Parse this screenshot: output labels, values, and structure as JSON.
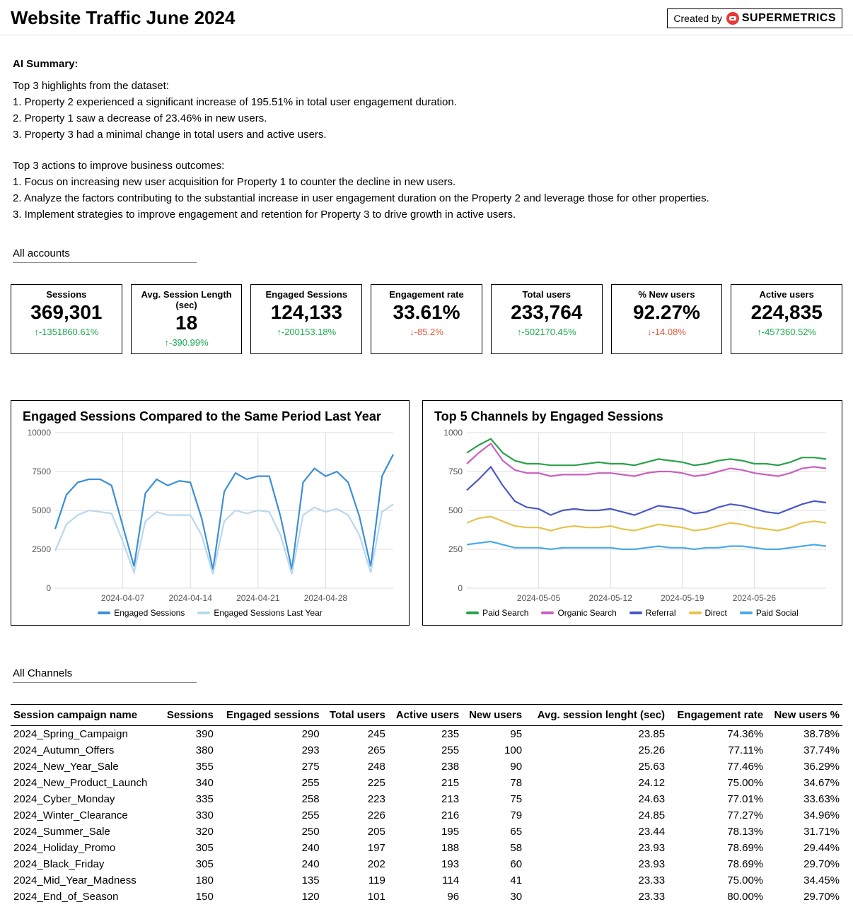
{
  "header": {
    "title": "Website Traffic June 2024",
    "created_by_label": "Created by",
    "brand": "SUPERMETRICS"
  },
  "summary": {
    "label": "AI Summary:",
    "highlights_label": "Top 3 highlights from the dataset:",
    "highlights": [
      "1. Property 2 experienced a significant increase of 195.51% in total user engagement duration.",
      "2. Property 1 saw a decrease of 23.46% in new users.",
      "3. Property 3 had a minimal change in total users and active users."
    ],
    "actions_label": "Top 3 actions to improve business outcomes:",
    "actions": [
      "1. Focus on increasing new user acquisition for Property 1 to counter the decline in new users.",
      "2. Analyze the factors contributing to the substantial increase in user engagement duration on the Property 2 and leverage those for other properties.",
      "3. Implement strategies to improve engagement and retention for Property 3 to drive growth in active users."
    ]
  },
  "filters": {
    "accounts": "All accounts",
    "channels": "All Channels"
  },
  "kpis": [
    {
      "label": "Sessions",
      "value": "369,301",
      "delta": "-1351860.61%",
      "dir": "up"
    },
    {
      "label": "Avg. Session Length (sec)",
      "value": "18",
      "delta": "-390.99%",
      "dir": "up"
    },
    {
      "label": "Engaged Sessions",
      "value": "124,133",
      "delta": "-200153.18%",
      "dir": "up"
    },
    {
      "label": "Engagement rate",
      "value": "33.61%",
      "delta": "-85.2%",
      "dir": "down"
    },
    {
      "label": "Total users",
      "value": "233,764",
      "delta": "-502170.45%",
      "dir": "up"
    },
    {
      "label": "% New users",
      "value": "92.27%",
      "delta": "-14.08%",
      "dir": "down"
    },
    {
      "label": "Active users",
      "value": "224,835",
      "delta": "-457360.52%",
      "dir": "up"
    }
  ],
  "chart_data": [
    {
      "type": "line",
      "title": "Engaged Sessions Compared to the Same Period Last Year",
      "xlabel": "",
      "ylabel": "",
      "x_ticks": [
        "2024-04-07",
        "2024-04-14",
        "2024-04-21",
        "2024-04-28"
      ],
      "ylim": [
        0,
        10000
      ],
      "y_ticks": [
        0,
        2500,
        5000,
        7500,
        10000
      ],
      "series": [
        {
          "name": "Engaged Sessions",
          "color": "#3b8fd6",
          "values": [
            3800,
            6000,
            6800,
            7000,
            7000,
            6600,
            4000,
            1400,
            6100,
            7000,
            6600,
            6900,
            6800,
            4500,
            1200,
            6200,
            7400,
            7000,
            7200,
            7200,
            4600,
            1200,
            6800,
            7700,
            7200,
            7500,
            6800,
            4600,
            1400,
            7200,
            8600
          ]
        },
        {
          "name": "Engaged Sessions Last Year",
          "color": "#b9d8ef",
          "values": [
            2400,
            4100,
            4700,
            5000,
            4900,
            4800,
            3000,
            1000,
            4300,
            4900,
            4700,
            4700,
            4700,
            3400,
            900,
            4300,
            5000,
            4800,
            5000,
            4900,
            3400,
            900,
            4700,
            5200,
            4900,
            5100,
            4700,
            3400,
            1000,
            4900,
            5400
          ]
        }
      ]
    },
    {
      "type": "line",
      "title": "Top 5 Channels by Engaged Sessions",
      "xlabel": "",
      "ylabel": "",
      "x_ticks": [
        "2024-05-05",
        "2024-05-12",
        "2024-05-19",
        "2024-05-26"
      ],
      "ylim": [
        0,
        1000
      ],
      "y_ticks": [
        0,
        250,
        500,
        750,
        1000
      ],
      "series": [
        {
          "name": "Paid Search",
          "color": "#2aa24a",
          "values": [
            870,
            920,
            960,
            870,
            820,
            800,
            800,
            790,
            790,
            790,
            800,
            810,
            800,
            800,
            790,
            810,
            830,
            820,
            810,
            790,
            800,
            820,
            830,
            820,
            800,
            800,
            790,
            810,
            840,
            840,
            830
          ]
        },
        {
          "name": "Organic Search",
          "color": "#c960c0",
          "values": [
            800,
            870,
            930,
            820,
            760,
            740,
            740,
            720,
            730,
            730,
            730,
            740,
            740,
            730,
            720,
            740,
            750,
            750,
            740,
            720,
            730,
            750,
            770,
            760,
            740,
            730,
            720,
            740,
            770,
            780,
            770
          ]
        },
        {
          "name": "Referral",
          "color": "#4a57c6",
          "values": [
            630,
            700,
            780,
            660,
            560,
            520,
            510,
            470,
            500,
            510,
            500,
            500,
            510,
            490,
            470,
            500,
            530,
            520,
            510,
            480,
            490,
            520,
            540,
            530,
            510,
            490,
            480,
            510,
            540,
            560,
            550
          ]
        },
        {
          "name": "Direct",
          "color": "#e7c24a",
          "values": [
            420,
            450,
            460,
            430,
            400,
            390,
            390,
            370,
            390,
            400,
            390,
            390,
            400,
            380,
            370,
            390,
            410,
            400,
            390,
            370,
            380,
            400,
            420,
            410,
            390,
            380,
            370,
            390,
            420,
            430,
            420
          ]
        },
        {
          "name": "Paid Social",
          "color": "#4aa9e7",
          "values": [
            280,
            290,
            300,
            280,
            260,
            260,
            260,
            250,
            260,
            260,
            260,
            260,
            260,
            250,
            250,
            260,
            270,
            260,
            260,
            250,
            260,
            260,
            270,
            270,
            260,
            250,
            250,
            260,
            270,
            280,
            270
          ]
        }
      ]
    }
  ],
  "table": {
    "columns": [
      "Session campaign name",
      "Sessions",
      "Engaged sessions",
      "Total users",
      "Active users",
      "New users",
      "Avg. session lenght (sec)",
      "Engagement rate",
      "New users %"
    ],
    "rows": [
      [
        "2024_Spring_Campaign",
        "390",
        "290",
        "245",
        "235",
        "95",
        "23.85",
        "74.36%",
        "38.78%"
      ],
      [
        "2024_Autumn_Offers",
        "380",
        "293",
        "265",
        "255",
        "100",
        "25.26",
        "77.11%",
        "37.74%"
      ],
      [
        "2024_New_Year_Sale",
        "355",
        "275",
        "248",
        "238",
        "90",
        "25.63",
        "77.46%",
        "36.29%"
      ],
      [
        "2024_New_Product_Launch",
        "340",
        "255",
        "225",
        "215",
        "78",
        "24.12",
        "75.00%",
        "34.67%"
      ],
      [
        "2024_Cyber_Monday",
        "335",
        "258",
        "223",
        "213",
        "75",
        "24.63",
        "77.01%",
        "33.63%"
      ],
      [
        "2024_Winter_Clearance",
        "330",
        "255",
        "226",
        "216",
        "79",
        "24.85",
        "77.27%",
        "34.96%"
      ],
      [
        "2024_Summer_Sale",
        "320",
        "250",
        "205",
        "195",
        "65",
        "23.44",
        "78.13%",
        "31.71%"
      ],
      [
        "2024_Holiday_Promo",
        "305",
        "240",
        "197",
        "188",
        "58",
        "23.93",
        "78.69%",
        "29.44%"
      ],
      [
        "2024_Black_Friday",
        "305",
        "240",
        "202",
        "193",
        "60",
        "23.93",
        "78.69%",
        "29.70%"
      ],
      [
        "2024_Mid_Year_Madness",
        "180",
        "135",
        "119",
        "114",
        "41",
        "23.33",
        "75.00%",
        "34.45%"
      ],
      [
        "2024_End_of_Season",
        "150",
        "120",
        "101",
        "96",
        "30",
        "23.33",
        "80.00%",
        "29.70%"
      ]
    ]
  }
}
